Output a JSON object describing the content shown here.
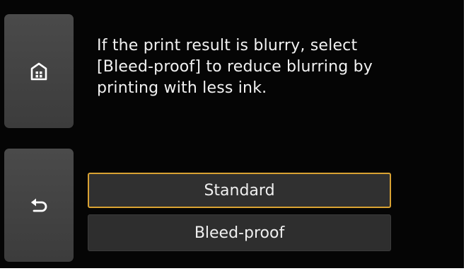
{
  "message": "If the print result is blurry, select [Bleed-proof] to reduce blurring by printing with less ink.",
  "options": [
    {
      "label": "Standard",
      "selected": true
    },
    {
      "label": "Bleed-proof",
      "selected": false
    }
  ],
  "nav": {
    "home_icon": "home-icon",
    "back_icon": "back-arrow-icon"
  },
  "colors": {
    "background": "#050505",
    "button": "#434343",
    "selected_border": "#d9a233",
    "text": "#f2f2f2"
  }
}
